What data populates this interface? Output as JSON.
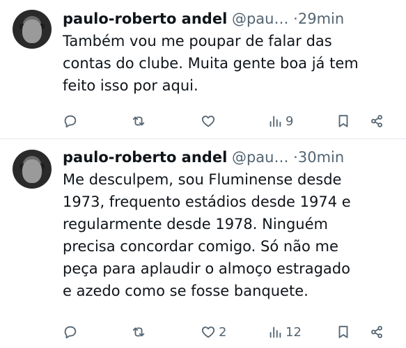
{
  "tweets": [
    {
      "name": "paulo-roberto andel",
      "handle": "@pau…",
      "separator": "·",
      "time": "29min",
      "lines": [
        "Também vou me poupar de falar das",
        "contas do clube. Muita gente boa já tem",
        "feito isso por aqui."
      ],
      "likes": "",
      "views": "9"
    },
    {
      "name": "paulo-roberto andel",
      "handle": "@pau…",
      "separator": "·",
      "time": "30min",
      "lines": [
        "Me desculpem, sou Fluminense desde",
        "1973, frequento estádios desde 1974 e",
        "regularmente desde 1978. Ninguém",
        "precisa concordar comigo. Só não me",
        "peça para aplaudir o almoço estragado",
        "e azedo como se fosse banquete."
      ],
      "likes": "2",
      "views": "12"
    }
  ],
  "icons": [
    "reply-icon",
    "retweet-icon",
    "like-icon",
    "views-icon",
    "bookmark-icon",
    "share-icon"
  ],
  "colors": {
    "text": "#0f1419",
    "secondary": "#536471",
    "divider": "#e3e7ea"
  }
}
